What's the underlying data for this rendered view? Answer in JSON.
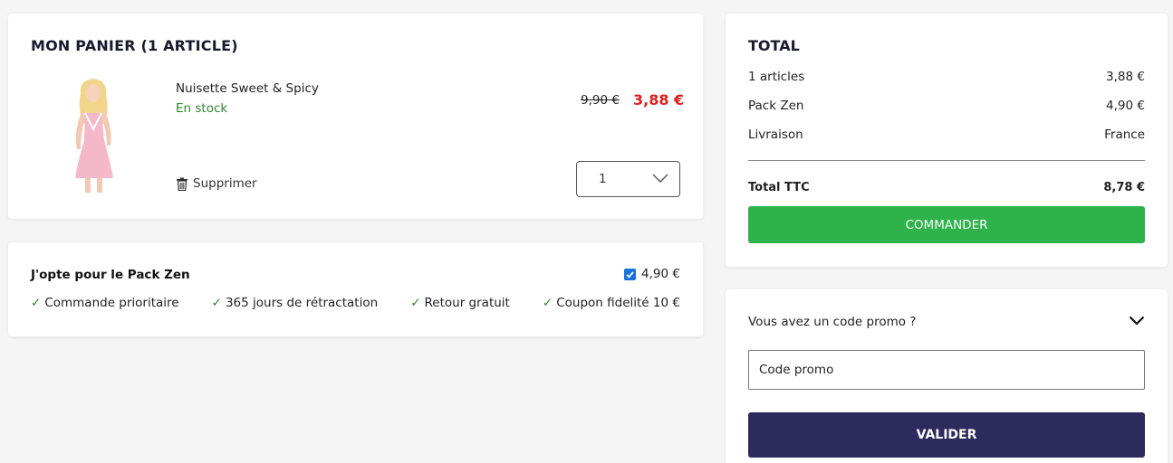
{
  "colors": {
    "green_stock": "#2a8a2a",
    "sale_red": "#e11d1d",
    "cta_green": "#2db34a",
    "validate_navy": "#2d2a5e",
    "checkbox_blue": "#1a73d9",
    "tick_green": "#2a8a2a"
  },
  "cart": {
    "title": "MON PANIER (1 ARTICLE)",
    "product": {
      "name": "Nuisette Sweet & Spicy",
      "stock": "En stock",
      "price_old": "9,90 €",
      "price_new": "3,88 €",
      "delete_label": "Supprimer",
      "quantity": "1"
    }
  },
  "pack": {
    "title": "J'opte pour le Pack Zen",
    "checked": true,
    "price": "4,90 €",
    "features": [
      "Commande prioritaire",
      "365 jours de rétractation",
      "Retour gratuit",
      "Coupon fidelité 10 €"
    ]
  },
  "total": {
    "title": "TOTAL",
    "rows": [
      {
        "label": "1 articles",
        "value": "3,88 €"
      },
      {
        "label": "Pack Zen",
        "value": "4,90 €"
      },
      {
        "label": "Livraison",
        "value": "France"
      }
    ],
    "ttc_label": "Total TTC",
    "ttc_value": "8,78 €",
    "cta_label": "COMMANDER"
  },
  "promo": {
    "question": "Vous avez un code promo ?",
    "placeholder": "Code promo",
    "validate_label": "VALIDER"
  }
}
